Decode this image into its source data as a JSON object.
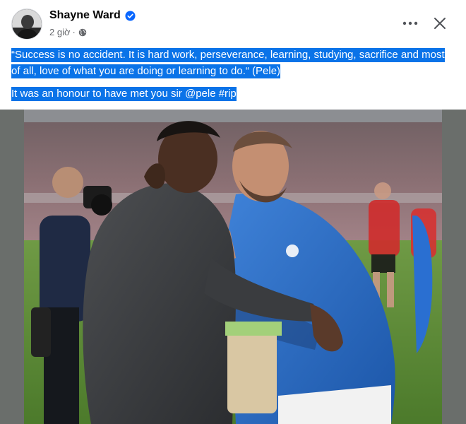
{
  "post": {
    "author": {
      "name": "Shayne Ward",
      "verified": true
    },
    "timestamp": "2 giờ",
    "separator": "·",
    "privacy_icon": "globe-icon",
    "more_icon": "more-horizontal-icon",
    "close_icon": "close-icon",
    "text": {
      "quote": "“Success is no accident. It is hard work, perseverance, learning, studying, sacrifice and most of all, love of what you are doing or learning to do.“ (Pele)",
      "caption": "It was an honour to have met you sir @pele #rip"
    },
    "photo_description": "two-men-embracing-on-football-pitch"
  },
  "colors": {
    "highlight": "#0a73e8",
    "verified": "#0866ff",
    "secondary_text": "#65676b",
    "media_background": "#6a6e6b"
  }
}
